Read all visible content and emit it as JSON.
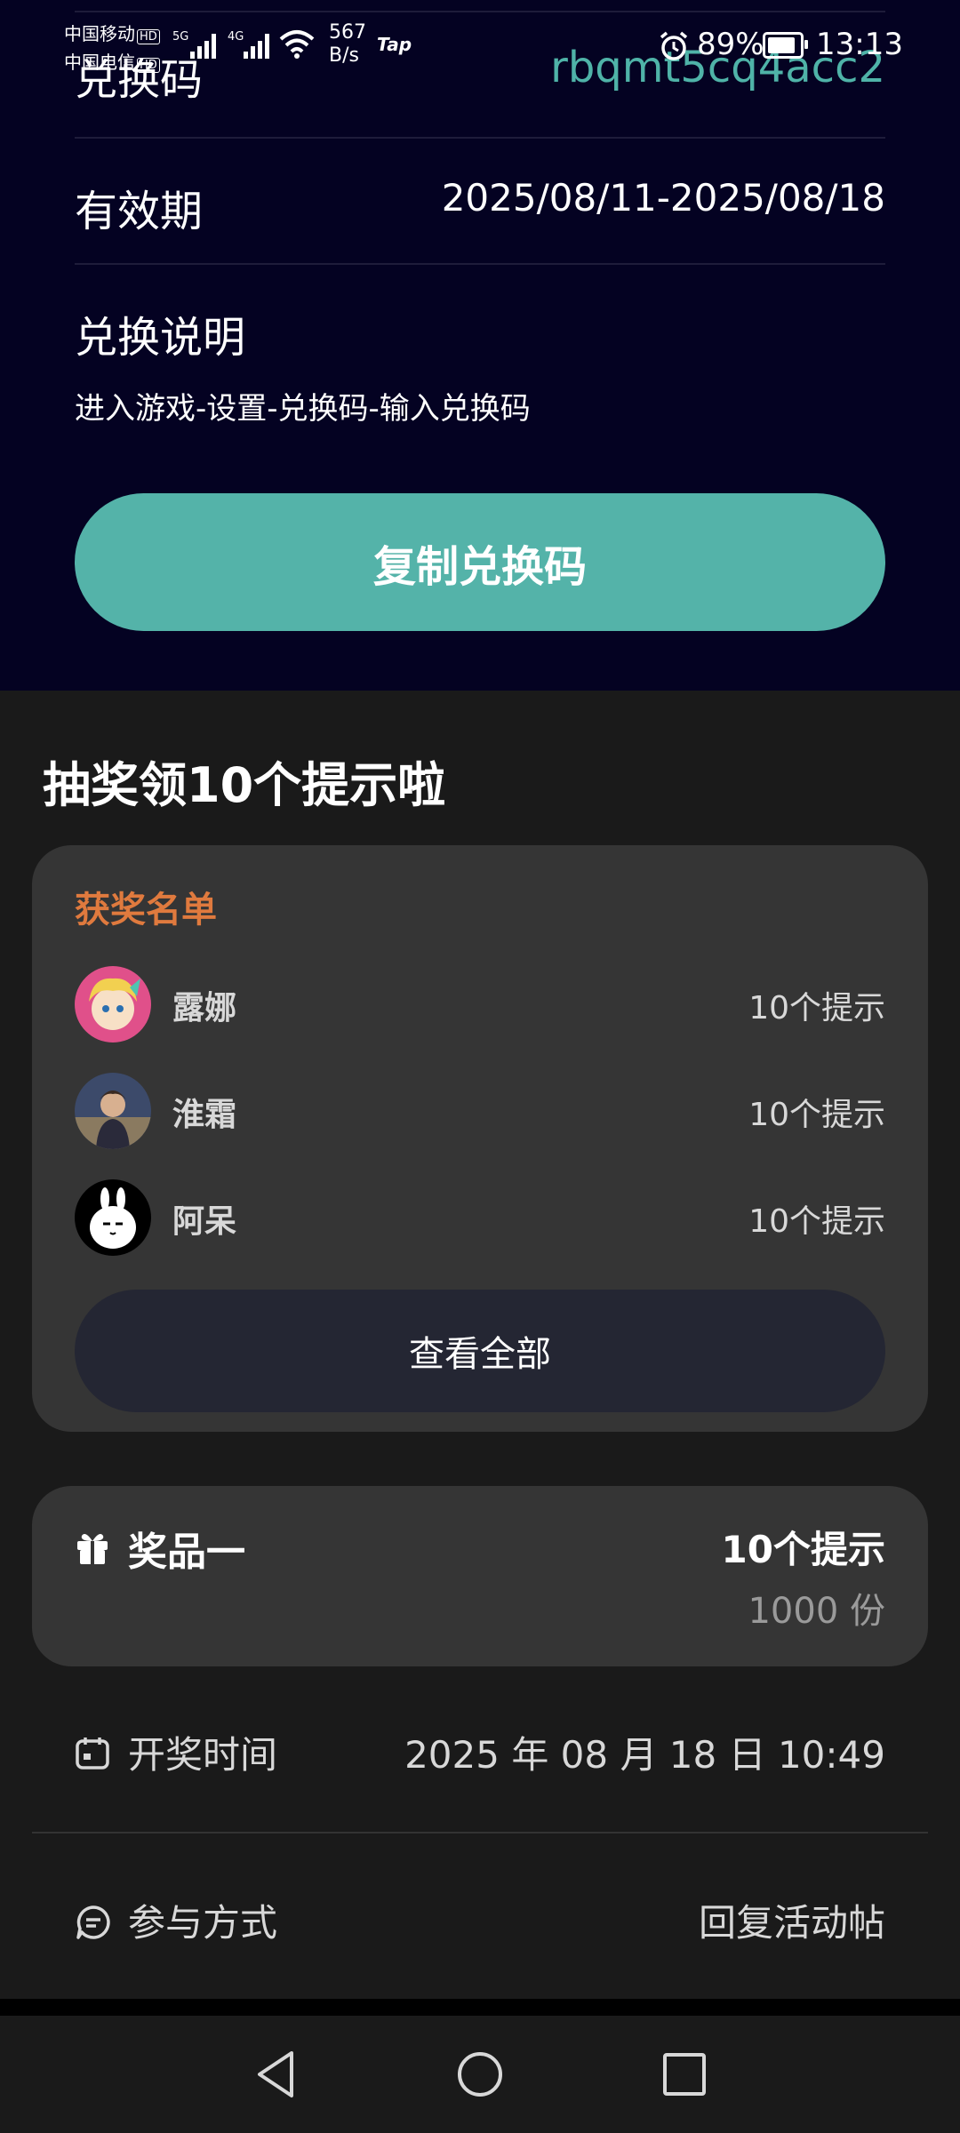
{
  "status_bar": {
    "carrier1": "中国移动",
    "carrier2": "中国电信",
    "hd": "HD",
    "net1": "5G",
    "net2": "4G",
    "speed_value": "567",
    "speed_unit": "B/s",
    "tap": "Tap",
    "battery": "89%",
    "battery_level": 0.89,
    "time": "13:13"
  },
  "redeem": {
    "code_label": "兑换码",
    "code_value": "rbqmt5cq4acc2",
    "validity_label": "有效期",
    "validity_value": "2025/08/11-2025/08/18",
    "instructions_label": "兑换说明",
    "instructions_text": "进入游戏-设置-兑换码-输入兑换码",
    "copy_button": "复制兑换码"
  },
  "lottery": {
    "title": "抽奖领10个提示啦",
    "winners_title": "获奖名单",
    "winners": [
      {
        "name": "露娜",
        "prize": "10个提示"
      },
      {
        "name": "淮霜",
        "prize": "10个提示"
      },
      {
        "name": "阿呆",
        "prize": "10个提示"
      }
    ],
    "view_all": "查看全部",
    "prize_name": "奖品一",
    "prize_value": "10个提示",
    "prize_quantity": "1000 份",
    "draw_time_label": "开奖时间",
    "draw_time_value": "2025 年 08 月 18 日 10:49",
    "participate_label": "参与方式",
    "participate_value": "回复活动帖"
  },
  "colors": {
    "accent": "#54b3a9",
    "code_text": "#4fb3a8",
    "winners_title": "#e07a3e",
    "top_bg": "#040222",
    "lower_bg": "#1a1a1a",
    "card_bg": "#353535"
  }
}
